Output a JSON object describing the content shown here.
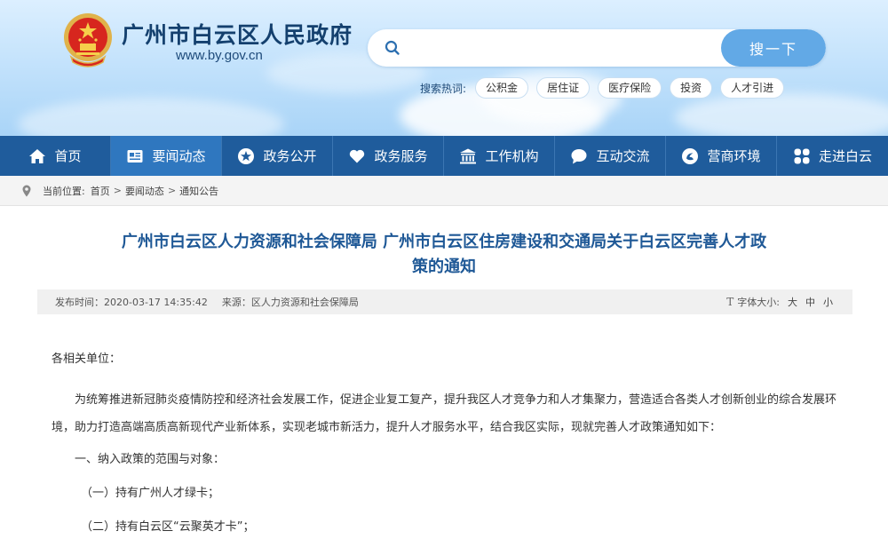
{
  "header": {
    "site_title": "广州市白云区人民政府",
    "site_url": "www.by.gov.cn",
    "search": {
      "placeholder": "",
      "button_label": "搜一下"
    },
    "hotwords": {
      "label": "搜索热词:",
      "items": [
        "公积金",
        "居住证",
        "医疗保险",
        "投资",
        "人才引进"
      ]
    }
  },
  "nav": {
    "items": [
      {
        "label": "首页",
        "icon": "home-icon"
      },
      {
        "label": "要闻动态",
        "icon": "news-icon",
        "active": true
      },
      {
        "label": "政务公开",
        "icon": "star-icon"
      },
      {
        "label": "政务服务",
        "icon": "heart-icon"
      },
      {
        "label": "工作机构",
        "icon": "building-icon"
      },
      {
        "label": "互动交流",
        "icon": "chat-icon"
      },
      {
        "label": "营商环境",
        "icon": "swirl-icon"
      },
      {
        "label": "走进白云",
        "icon": "grid-icon"
      }
    ]
  },
  "breadcrumb": {
    "label": "当前位置:",
    "items": [
      "首页",
      "要闻动态",
      "通知公告"
    ],
    "separator": ">"
  },
  "article": {
    "title_line1": "广州市白云区人力资源和社会保障局 广州市白云区住房建设和交通局关于白云区完善人才政",
    "title_line2": "策的通知",
    "meta": {
      "date": "发布时间：2020-03-17 14:35:42",
      "source": "来源：区人力资源和社会保障局",
      "font_size_label": "字体大小:",
      "font_sizes": [
        "大",
        "中",
        "小"
      ]
    },
    "paragraphs": {
      "salutation": "各相关单位：",
      "main": "为统筹推进新冠肺炎疫情防控和经济社会发展工作，促进企业复工复产，提升我区人才竞争力和人才集聚力，营造适合各类人才创新创业的综合发展环境，助力打造高端高质高新现代产业新体系，实现老城市新活力，提升人才服务水平，结合我区实际，现就完善人才政策通知如下：",
      "heading": "一、纳入政策的范围与对象：",
      "item1": "（一）持有广州人才绿卡；",
      "item2": "（二）持有白云区“云聚英才卡”；"
    }
  },
  "colors": {
    "nav_bg": "#1f5c9c",
    "nav_active": "#2f77bf",
    "title_blue": "#1e5896",
    "search_button": "#62a9e6"
  }
}
